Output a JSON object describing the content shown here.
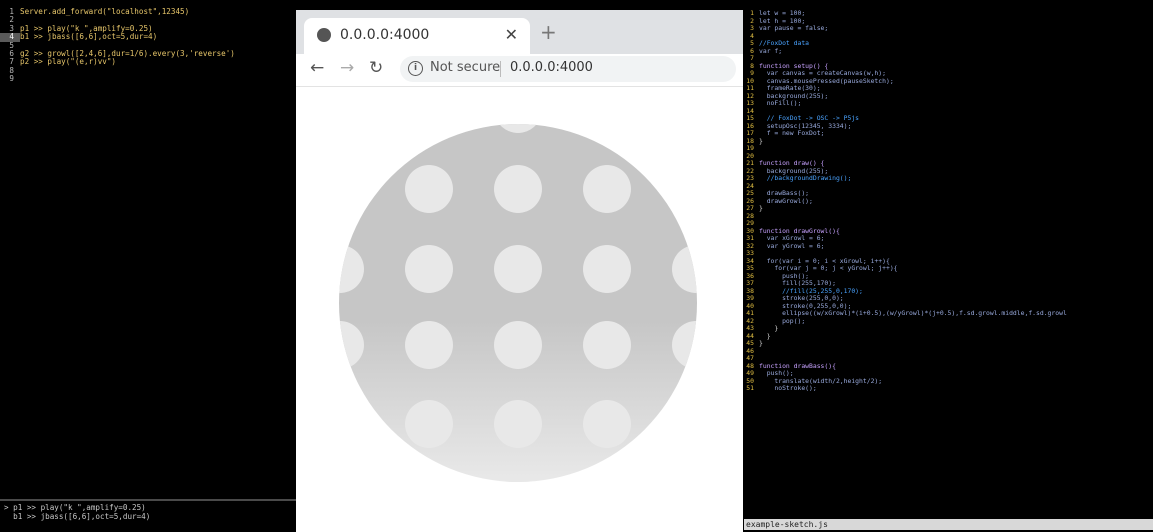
{
  "left_editor": {
    "lines": [
      {
        "n": "1",
        "t": "Server.add_forward(\"localhost\",12345)"
      },
      {
        "n": "2",
        "t": ""
      },
      {
        "n": "3",
        "t": "p1 >> play(\"k \",amplify=0.25)"
      },
      {
        "n": "4",
        "t": "b1 >> jbass([6,6],oct=5,dur=4)"
      },
      {
        "n": "5",
        "t": ""
      },
      {
        "n": "6",
        "t": "g2 >> growl([2,4,6],dur=1/6).every(3,'reverse')"
      },
      {
        "n": "7",
        "t": "p2 >> play(\"(e,r)vv\")"
      },
      {
        "n": "8",
        "t": ""
      },
      {
        "n": "9",
        "t": ""
      }
    ],
    "console": [
      "> p1 >> play(\"k \",amplify=0.25)",
      "  b1 >> jbass([6,6],oct=5,dur=4)"
    ]
  },
  "browser": {
    "tab_title": "0.0.0.0:4000",
    "close_glyph": "✕",
    "newtab_glyph": "+",
    "back_glyph": "←",
    "forward_glyph": "→",
    "reload_glyph": "↻",
    "info_glyph": "i",
    "not_secure": "Not secure",
    "url": "0.0.0.0:4000"
  },
  "sketch": {
    "circle_fill_top": "#c6c6c6",
    "circle_fill_bottom": "#e9e9e9",
    "dot_color": "#e8e8e8",
    "rows": 5,
    "cols": 5
  },
  "right_editor": {
    "lines": [
      {
        "n": "1",
        "t": "let w = 100;",
        "c": ""
      },
      {
        "n": "2",
        "t": "let h = 100;",
        "c": ""
      },
      {
        "n": "3",
        "t": "var pause = false;",
        "c": ""
      },
      {
        "n": "4",
        "t": "",
        "c": ""
      },
      {
        "n": "5",
        "t": "//FoxDot data",
        "c": "c"
      },
      {
        "n": "6",
        "t": "var f;",
        "c": ""
      },
      {
        "n": "7",
        "t": "",
        "c": ""
      },
      {
        "n": "8",
        "t": "function setup() {",
        "c": "f"
      },
      {
        "n": "9",
        "t": "  var canvas = createCanvas(w,h);",
        "c": ""
      },
      {
        "n": "10",
        "t": "  canvas.mousePressed(pauseSketch);",
        "c": ""
      },
      {
        "n": "11",
        "t": "  frameRate(30);",
        "c": ""
      },
      {
        "n": "12",
        "t": "  background(255);",
        "c": ""
      },
      {
        "n": "13",
        "t": "  noFill();",
        "c": ""
      },
      {
        "n": "14",
        "t": "",
        "c": ""
      },
      {
        "n": "15",
        "t": "  // FoxDot -> OSC -> P5js",
        "c": "c"
      },
      {
        "n": "16",
        "t": "  setupOsc(12345, 3334);",
        "c": ""
      },
      {
        "n": "17",
        "t": "  f = new FoxDot;",
        "c": ""
      },
      {
        "n": "18",
        "t": "}",
        "c": "b"
      },
      {
        "n": "19",
        "t": "",
        "c": ""
      },
      {
        "n": "20",
        "t": "",
        "c": ""
      },
      {
        "n": "21",
        "t": "function draw() {",
        "c": "f"
      },
      {
        "n": "22",
        "t": "  background(255);",
        "c": ""
      },
      {
        "n": "23",
        "t": "  //backgroundDrawing();",
        "c": "c"
      },
      {
        "n": "24",
        "t": "",
        "c": ""
      },
      {
        "n": "25",
        "t": "  drawBass();",
        "c": ""
      },
      {
        "n": "26",
        "t": "  drawGrowl();",
        "c": ""
      },
      {
        "n": "27",
        "t": "}",
        "c": "b"
      },
      {
        "n": "28",
        "t": "",
        "c": ""
      },
      {
        "n": "29",
        "t": "",
        "c": ""
      },
      {
        "n": "30",
        "t": "function drawGrowl(){",
        "c": "f"
      },
      {
        "n": "31",
        "t": "  var xGrowl = 6;",
        "c": ""
      },
      {
        "n": "32",
        "t": "  var yGrowl = 6;",
        "c": ""
      },
      {
        "n": "33",
        "t": "",
        "c": ""
      },
      {
        "n": "34",
        "t": "  for(var i = 0; i < xGrowl; i++){",
        "c": ""
      },
      {
        "n": "35",
        "t": "    for(var j = 0; j < yGrowl; j++){",
        "c": ""
      },
      {
        "n": "36",
        "t": "      push();",
        "c": ""
      },
      {
        "n": "37",
        "t": "      fill(255,170);",
        "c": ""
      },
      {
        "n": "38",
        "t": "      //fill(25,255,0,170);",
        "c": "c"
      },
      {
        "n": "39",
        "t": "      stroke(255,0,0);",
        "c": ""
      },
      {
        "n": "40",
        "t": "      stroke(0,255,0,0);",
        "c": ""
      },
      {
        "n": "41",
        "t": "      ellipse((w/xGrowl)*(i+0.5),(w/yGrowl)*(j+0.5),f.sd.growl.middle,f.sd.growl",
        "c": ""
      },
      {
        "n": "42",
        "t": "      pop();",
        "c": ""
      },
      {
        "n": "43",
        "t": "    }",
        "c": "b"
      },
      {
        "n": "44",
        "t": "  }",
        "c": "b"
      },
      {
        "n": "45",
        "t": "}",
        "c": "b"
      },
      {
        "n": "46",
        "t": "",
        "c": ""
      },
      {
        "n": "47",
        "t": "",
        "c": ""
      },
      {
        "n": "48",
        "t": "function drawBass(){",
        "c": "f"
      },
      {
        "n": "49",
        "t": "  push();",
        "c": ""
      },
      {
        "n": "50",
        "t": "    translate(width/2,height/2);",
        "c": ""
      },
      {
        "n": "51",
        "t": "    noStroke();",
        "c": ""
      }
    ],
    "status_filename": "example-sketch.js"
  }
}
